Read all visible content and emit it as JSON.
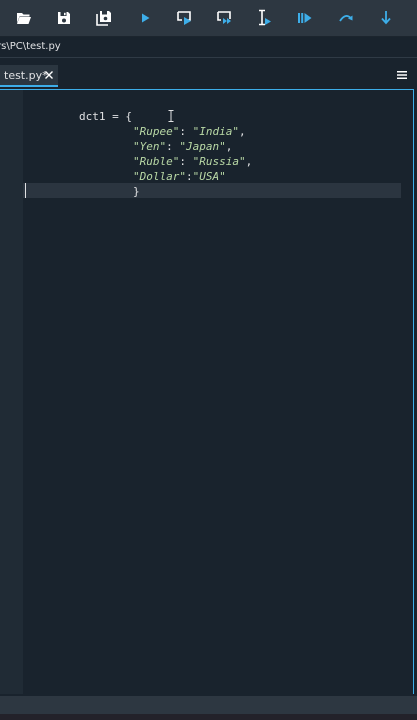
{
  "toolbar": {
    "buttons": [
      {
        "icon": "folder-open-icon"
      },
      {
        "icon": "save-icon"
      },
      {
        "icon": "save-all-icon"
      },
      {
        "icon": "run-icon"
      },
      {
        "icon": "run-cell-icon"
      },
      {
        "icon": "run-cell-advance-icon"
      },
      {
        "icon": "run-selection-icon"
      },
      {
        "icon": "debug-icon"
      },
      {
        "icon": "step-over-icon"
      },
      {
        "icon": "step-into-icon"
      }
    ],
    "accent": "#3daee9"
  },
  "path_bar": {
    "path": "rs\\PC\\test.py"
  },
  "editor_tabs": [
    {
      "label": "test.py*",
      "active": true
    }
  ],
  "editor": {
    "code": {
      "line1": {
        "text": "dct1 = {"
      },
      "line2": {
        "key": "\"Rupee\"",
        "sep": ": ",
        "value": "\"India\"",
        "end": ","
      },
      "line3": {
        "key": "\"Yen\"",
        "sep": ": ",
        "value": "\"Japan\"",
        "end": ","
      },
      "line4": {
        "key": "\"Ruble\"",
        "sep": ": ",
        "value": "\"Russia\"",
        "end": ","
      },
      "line5": {
        "key": "\"Dollar\"",
        "sep": ":",
        "value": "\"USA\"",
        "end": ""
      },
      "line6": {
        "text": "}"
      }
    },
    "string_color": "#b9d9a6",
    "text_color": "#e0e1e3"
  }
}
